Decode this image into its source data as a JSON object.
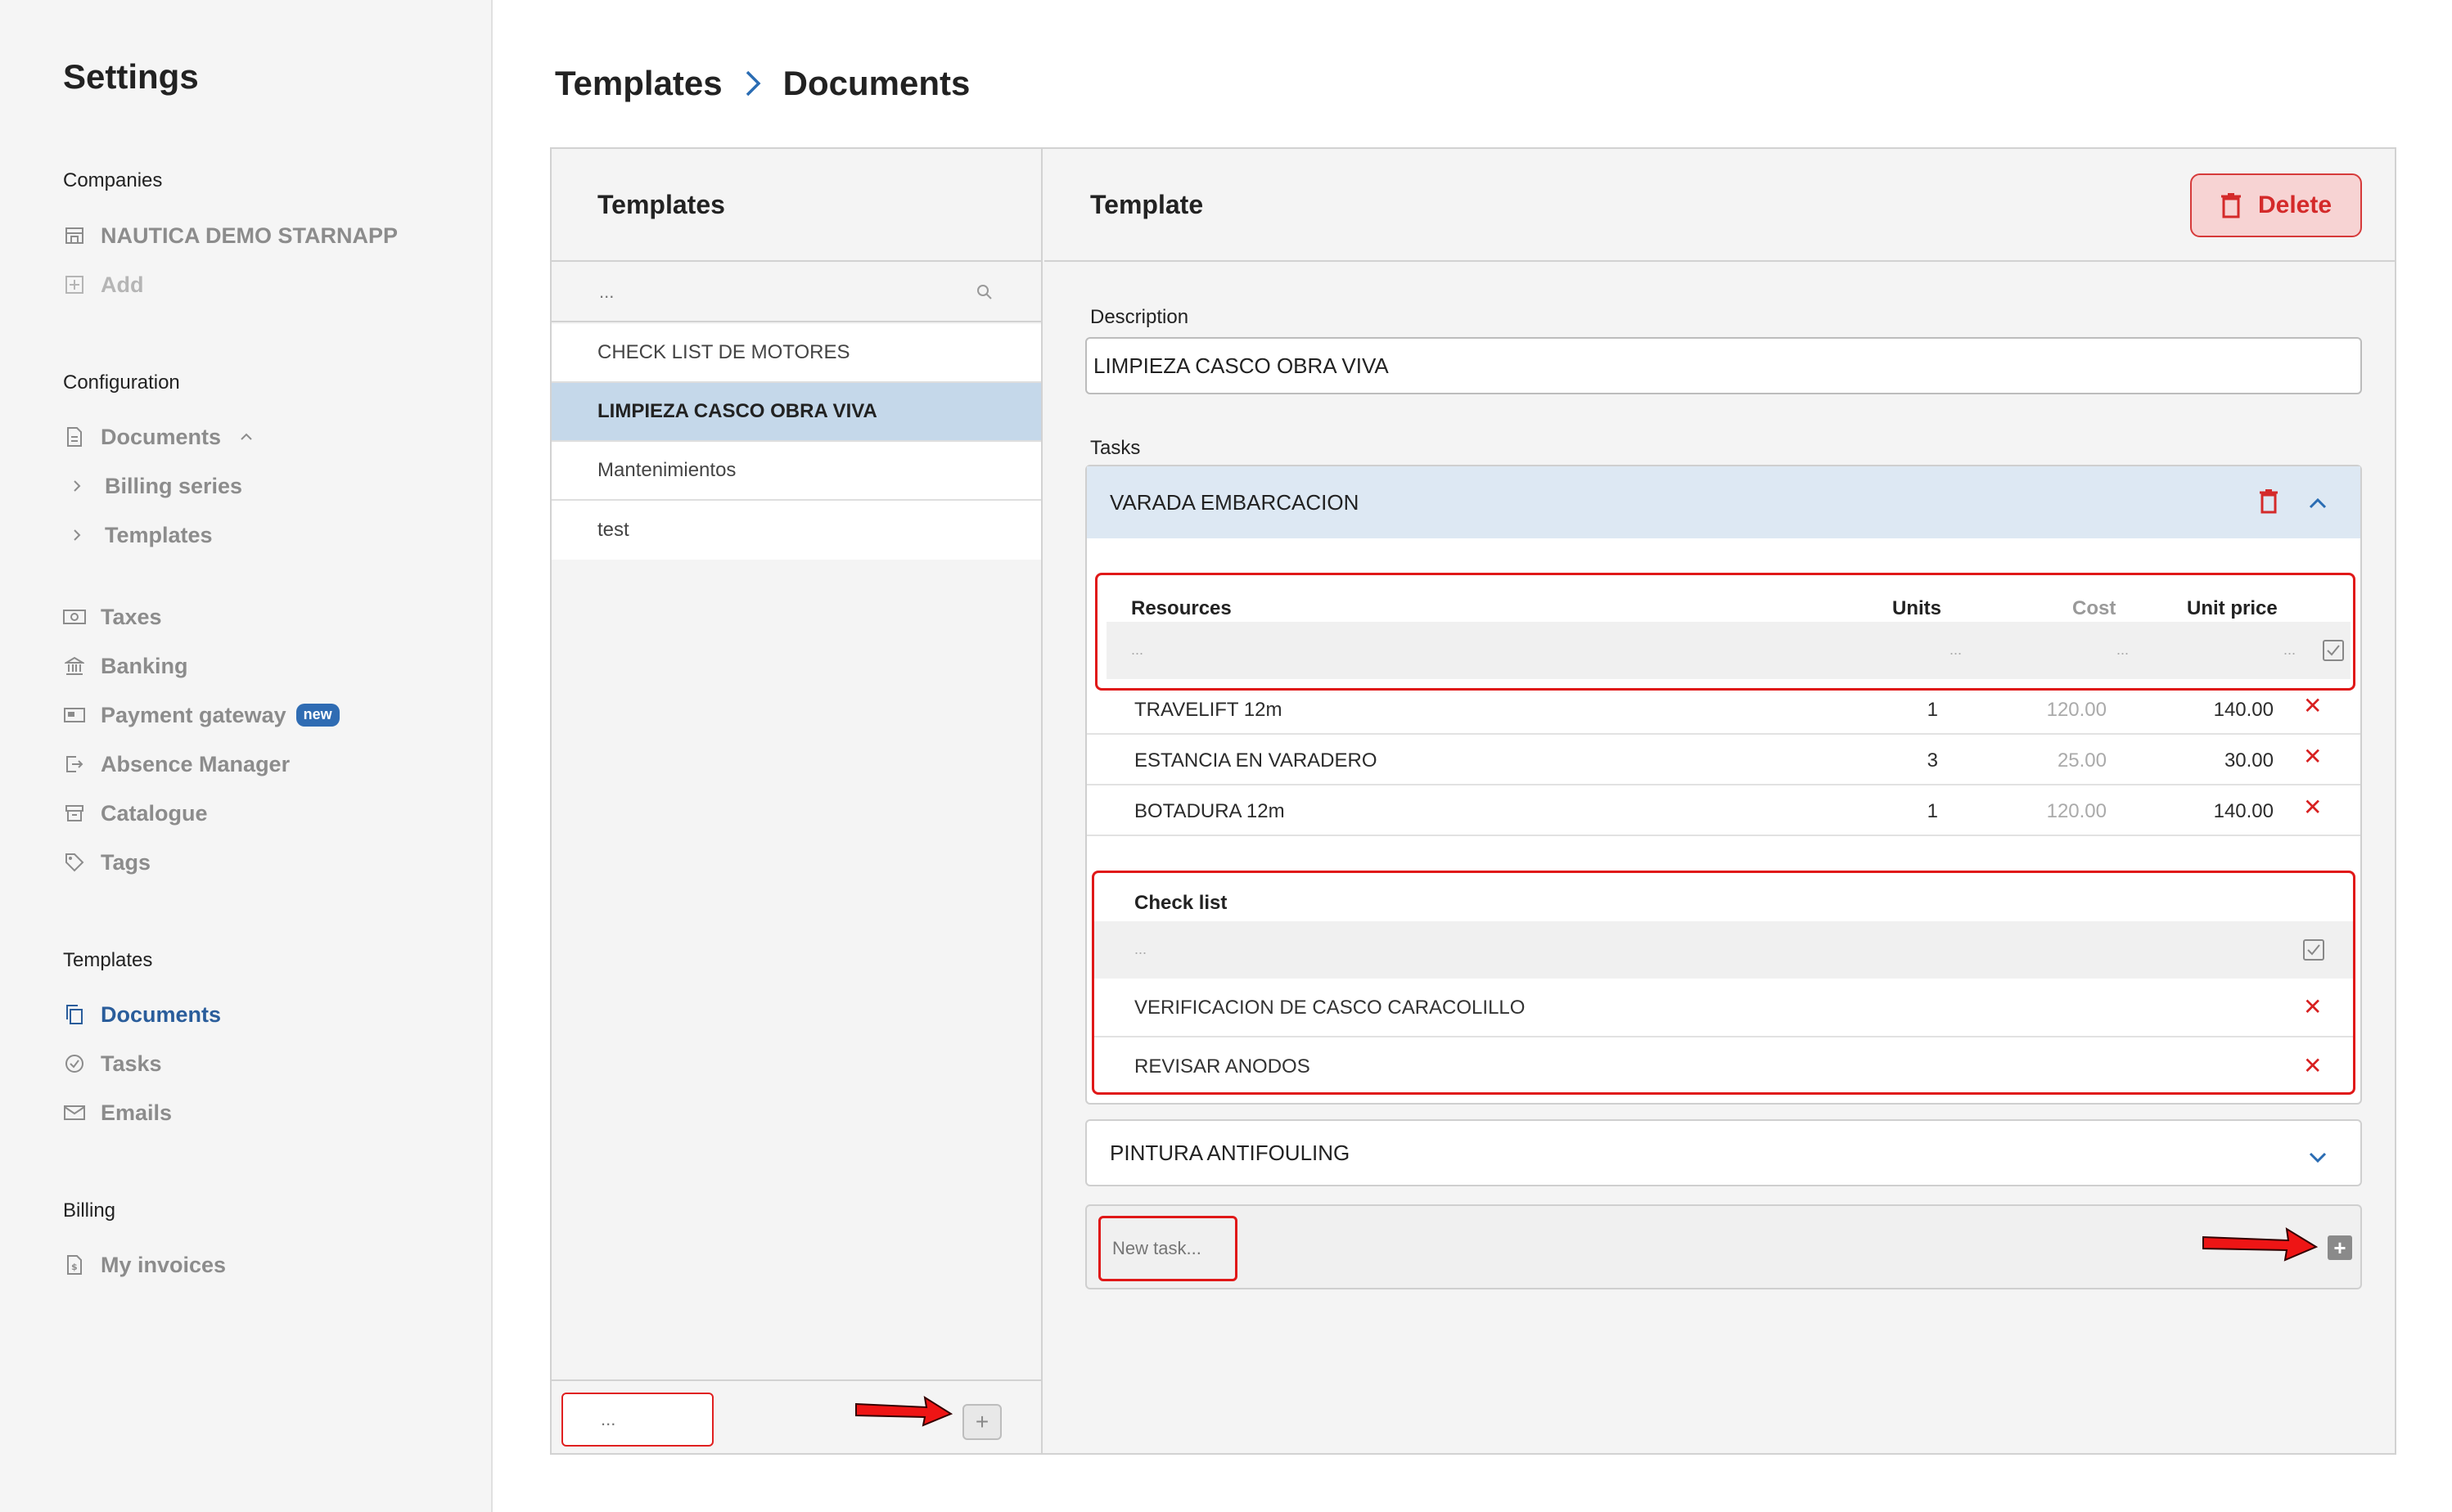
{
  "sidebar": {
    "title": "Settings",
    "companies_label": "Companies",
    "companies": [
      {
        "label": "NAUTICA DEMO STARNAPP",
        "icon": "store-icon"
      },
      {
        "label": "Add",
        "icon": "plus-square-icon"
      }
    ],
    "configuration_label": "Configuration",
    "configuration": [
      {
        "label": "Documents",
        "icon": "document-icon"
      },
      {
        "label": "Billing series",
        "icon": "chevron-right-icon"
      },
      {
        "label": "Templates",
        "icon": "chevron-right-icon"
      },
      {
        "label": "Taxes",
        "icon": "money-icon"
      },
      {
        "label": "Banking",
        "icon": "bank-icon"
      },
      {
        "label": "Payment gateway",
        "icon": "payment-icon",
        "badge": "new"
      },
      {
        "label": "Absence Manager",
        "icon": "exit-icon"
      },
      {
        "label": "Catalogue",
        "icon": "archive-icon"
      },
      {
        "label": "Tags",
        "icon": "tag-icon"
      }
    ],
    "templates_label": "Templates",
    "templates": [
      {
        "label": "Documents",
        "icon": "copy-icon",
        "active": true
      },
      {
        "label": "Tasks",
        "icon": "check-circle-icon"
      },
      {
        "label": "Emails",
        "icon": "mail-icon"
      }
    ],
    "billing_label": "Billing",
    "billing": [
      {
        "label": "My invoices",
        "icon": "invoice-icon"
      }
    ]
  },
  "breadcrumb": {
    "parent": "Templates",
    "current": "Documents"
  },
  "templates_panel": {
    "title": "Templates",
    "search_placeholder": "...",
    "items": [
      {
        "label": "CHECK LIST DE MOTORES",
        "selected": false
      },
      {
        "label": "LIMPIEZA CASCO OBRA VIVA",
        "selected": true
      },
      {
        "label": "Mantenimientos",
        "selected": false
      },
      {
        "label": "test",
        "selected": false
      }
    ],
    "new_placeholder": "...",
    "add_label": "+"
  },
  "template_panel": {
    "title": "Template",
    "delete_label": "Delete",
    "description_label": "Description",
    "description_value": "LIMPIEZA CASCO OBRA VIVA",
    "tasks_label": "Tasks",
    "tasks": [
      {
        "name": "VARADA EMBARCACION",
        "expanded": true,
        "resources": {
          "headers": {
            "name": "Resources",
            "units": "Units",
            "cost": "Cost",
            "unit_price": "Unit price"
          },
          "input_placeholder": "...",
          "rows": [
            {
              "name": "TRAVELIFT 12m",
              "units": "1",
              "cost": "120.00",
              "unit_price": "140.00"
            },
            {
              "name": "ESTANCIA EN VARADERO",
              "units": "3",
              "cost": "25.00",
              "unit_price": "30.00"
            },
            {
              "name": "BOTADURA 12m",
              "units": "1",
              "cost": "120.00",
              "unit_price": "140.00"
            }
          ]
        },
        "checklist": {
          "header": "Check list",
          "input_placeholder": "...",
          "items": [
            "VERIFICACION DE CASCO CARACOLILLO",
            "REVISAR ANODOS"
          ]
        }
      },
      {
        "name": "PINTURA ANTIFOULING",
        "expanded": false
      }
    ],
    "new_task_placeholder": "New task..."
  },
  "colors": {
    "accent": "#2a5d9b",
    "selected_row": "#c5d8ea",
    "task_header": "#dde8f3",
    "danger": "#d42a2a",
    "annotation_red": "#e01818"
  }
}
